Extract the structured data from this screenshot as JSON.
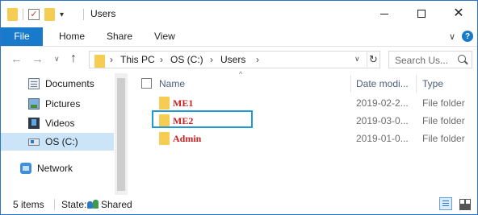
{
  "window": {
    "title": "Users",
    "controls": {
      "minimize": "minimize",
      "maximize": "maximize",
      "close": "✕"
    }
  },
  "quick_access": {
    "dropdown": "▾"
  },
  "ribbon": {
    "tabs": [
      {
        "label": "File"
      },
      {
        "label": "Home"
      },
      {
        "label": "Share"
      },
      {
        "label": "View"
      }
    ],
    "expand": "∨",
    "help": "?"
  },
  "navigation": {
    "back": "←",
    "forward": "→",
    "recent": "∨",
    "up": "↑",
    "breadcrumb_sep": "›",
    "breadcrumb": [
      "This PC",
      "OS (C:)",
      "Users"
    ],
    "address_dropdown": "∨",
    "refresh": "↻",
    "search_placeholder": "Search Us..."
  },
  "sidebar": {
    "items": [
      {
        "label": "Documents",
        "icon": "documents-icon"
      },
      {
        "label": "Pictures",
        "icon": "pictures-icon"
      },
      {
        "label": "Videos",
        "icon": "videos-icon"
      },
      {
        "label": "OS (C:)",
        "icon": "drive-icon",
        "selected": true
      },
      {
        "label": "Network",
        "icon": "network-icon"
      }
    ]
  },
  "filelist": {
    "sort_indicator": "^",
    "columns": {
      "name": "Name",
      "date": "Date modi...",
      "type": "Type"
    },
    "rows": [
      {
        "name": "ME1",
        "date": "2019-02-2...",
        "type": "File folder"
      },
      {
        "name": "ME2",
        "date": "2019-03-0...",
        "type": "File folder"
      },
      {
        "name": "Admin",
        "date": "2019-01-0...",
        "type": "File folder"
      }
    ]
  },
  "status": {
    "items_count": "5 items",
    "state_label": "State:",
    "state_value": "Shared"
  },
  "colors": {
    "accent": "#1979ca",
    "selected_bg": "#cce4f7",
    "folder_name": "#cc1f1f",
    "highlight_box": "#1f9ad6",
    "folder": "#f3c84a"
  }
}
